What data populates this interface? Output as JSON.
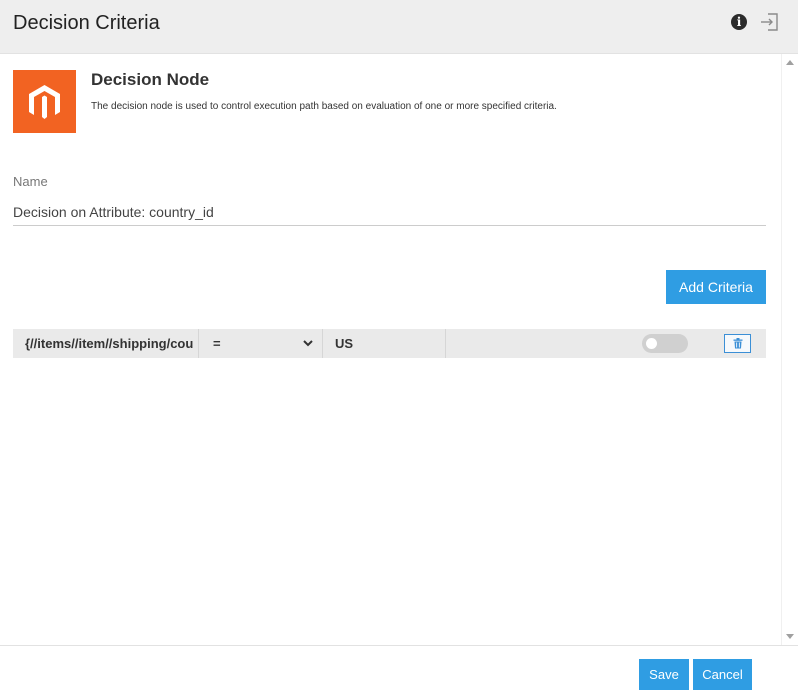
{
  "header": {
    "title": "Decision Criteria",
    "info_icon": "info-icon",
    "exit_icon": "exit-icon"
  },
  "node": {
    "logo_icon": "magento-logo",
    "logo_color": "#f26322",
    "title": "Decision Node",
    "description": "The decision node is used to control execution path based on evaluation of one or more specified criteria."
  },
  "form": {
    "name_label": "Name",
    "name_value": "Decision on Attribute: country_id"
  },
  "criteria": {
    "add_label": "Add Criteria",
    "rows": [
      {
        "attribute": "{//items//item//shipping/country_id}",
        "operator": "=",
        "value": "US",
        "enabled": false
      }
    ]
  },
  "footer": {
    "save_label": "Save",
    "cancel_label": "Cancel"
  },
  "colors": {
    "accent": "#2f9de3",
    "header_bg": "#eeeeee",
    "row_bg": "#eaeaea"
  }
}
